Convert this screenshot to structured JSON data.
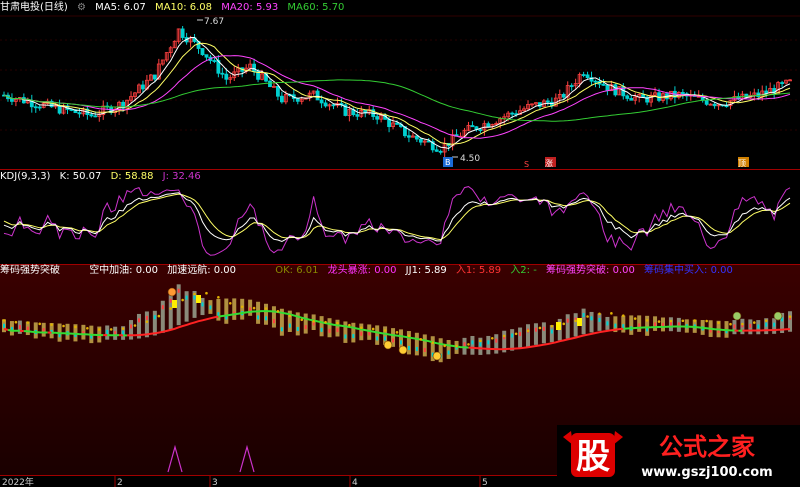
{
  "colors": {
    "bg": "#000000",
    "frame": "#8b0000",
    "up": "#ff4040",
    "down": "#00d0d0",
    "ma5": "#ffffff",
    "ma10": "#ffff66",
    "ma20": "#ff44ff",
    "ma60": "#33cc33",
    "kdj_k": "#ffffff",
    "kdj_d": "#ffff66",
    "kdj_j": "#cc33cc",
    "lower_bg_top": "#3a0000",
    "lower_bg_bottom": "#200000"
  },
  "header_main": {
    "title": "甘肃电投(日线)",
    "ma5": "MA5: 6.07",
    "ma10": "MA10: 6.08",
    "ma20": "MA20: 5.93",
    "ma60": "MA60: 5.70"
  },
  "header_kdj": {
    "title": "KDJ(9,3,3)",
    "k": "K: 50.07",
    "d": "D: 58.88",
    "j": "J: 32.46"
  },
  "header_lower": {
    "title": "筹码强势突破",
    "kong": "空中加油: 0.00",
    "jiasu": "加速远航: 0.00",
    "ok": "OK: 6.01",
    "longtou": "龙头暴涨: 0.00",
    "jj1": "JJ1: 5.89",
    "ru1": "入1: 5.89",
    "ru2": "入2: -",
    "chouma": "筹码强势突破: 0.00",
    "jizhong": "筹码集中买入: 0.00"
  },
  "annotations": {
    "high": "7.67",
    "low": "4.50",
    "flag1": "B",
    "flag2": "S",
    "flag3": "涨",
    "flag4": "顶"
  },
  "xaxis": {
    "year": "2022年",
    "m2": "2",
    "m3": "3",
    "m4": "4",
    "m5": "5"
  },
  "watermark": {
    "logo": "股",
    "title": "公式之家",
    "url": "www.gszj100.com"
  },
  "chart_data": [
    {
      "type": "candlestick",
      "title": "甘肃电投(日线)",
      "x": [
        "2022-01",
        "2022-02",
        "2022-03",
        "2022-04",
        "2022-05"
      ],
      "price_high": 7.67,
      "price_low": 4.5,
      "series": [
        {
          "name": "MA5",
          "last": 6.07
        },
        {
          "name": "MA10",
          "last": 6.08
        },
        {
          "name": "MA20",
          "last": 5.93
        },
        {
          "name": "MA60",
          "last": 5.7
        }
      ]
    },
    {
      "type": "line",
      "title": "KDJ(9,3,3)",
      "series": [
        {
          "name": "K",
          "last": 50.07
        },
        {
          "name": "D",
          "last": 58.88
        },
        {
          "name": "J",
          "last": 32.46
        }
      ]
    },
    {
      "type": "bar",
      "title": "筹码强势突破",
      "series": [
        {
          "name": "OK",
          "last": 6.01
        },
        {
          "name": "JJ1",
          "last": 5.89
        },
        {
          "name": "入1",
          "last": 5.89
        }
      ]
    }
  ]
}
